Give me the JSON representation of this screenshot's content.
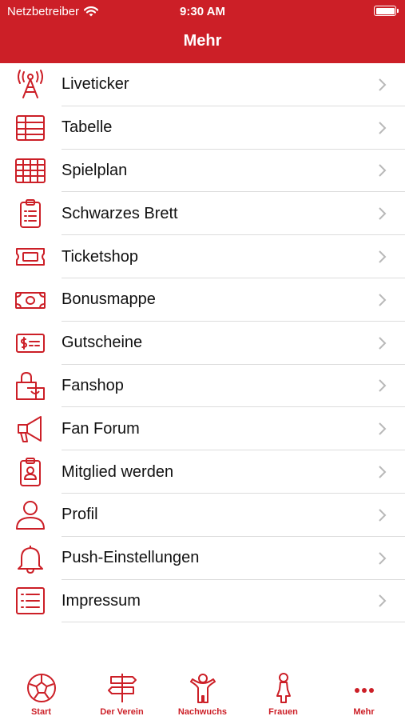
{
  "status_bar": {
    "carrier": "Netzbetreiber",
    "time": "9:30 AM"
  },
  "header": {
    "title": "Mehr"
  },
  "colors": {
    "accent": "#cc1f27",
    "separator": "#dcdcdc",
    "chevron": "#b8b8b8"
  },
  "menu": [
    {
      "label": "Liveticker",
      "icon": "antenna-icon"
    },
    {
      "label": "Tabelle",
      "icon": "table-icon"
    },
    {
      "label": "Spielplan",
      "icon": "grid-icon"
    },
    {
      "label": "Schwarzes Brett",
      "icon": "clipboard-icon"
    },
    {
      "label": "Ticketshop",
      "icon": "ticket-icon"
    },
    {
      "label": "Bonusmappe",
      "icon": "banknote-icon"
    },
    {
      "label": "Gutscheine",
      "icon": "voucher-icon"
    },
    {
      "label": "Fanshop",
      "icon": "shopping-bag-icon"
    },
    {
      "label": "Fan Forum",
      "icon": "megaphone-icon"
    },
    {
      "label": "Mitglied werden",
      "icon": "id-badge-icon"
    },
    {
      "label": "Profil",
      "icon": "person-icon"
    },
    {
      "label": "Push-Einstellungen",
      "icon": "bell-icon"
    },
    {
      "label": "Impressum",
      "icon": "list-icon"
    }
  ],
  "tabs": [
    {
      "label": "Start",
      "icon": "soccer-ball-icon"
    },
    {
      "label": "Der Verein",
      "icon": "signpost-icon"
    },
    {
      "label": "Nachwuchs",
      "icon": "child-icon"
    },
    {
      "label": "Frauen",
      "icon": "woman-icon"
    },
    {
      "label": "Mehr",
      "icon": "more-dots-icon"
    }
  ]
}
